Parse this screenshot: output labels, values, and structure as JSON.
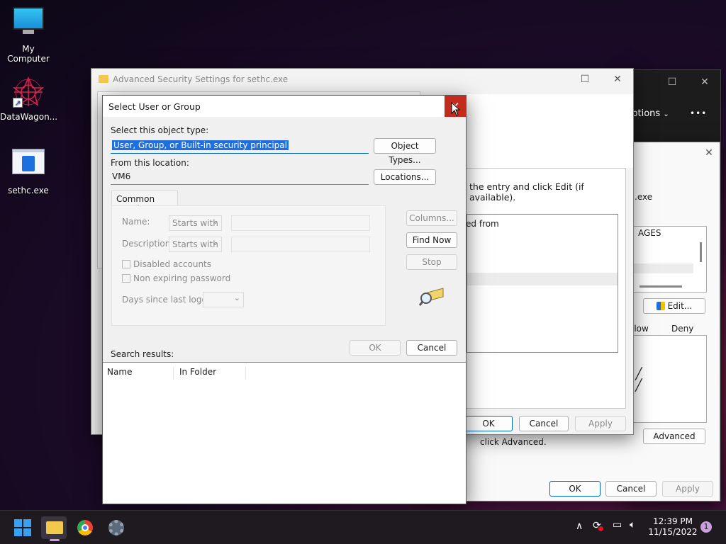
{
  "desktop": {
    "icons": [
      {
        "label": "My Computer"
      },
      {
        "label": "DataWagon..."
      },
      {
        "label": "sethc.exe"
      }
    ]
  },
  "back_window": {
    "menu_options": "Options",
    "more": "•••"
  },
  "properties_window": {
    "file_label": ".exe",
    "principal_label": "AGES",
    "edit_button": "Edit...",
    "col_allow": "llow",
    "col_deny": "Deny",
    "advanced_text": "click Advanced.",
    "advanced_button": "Advanced",
    "ok": "OK",
    "cancel": "Cancel",
    "apply": "Apply"
  },
  "adv_window": {
    "title": "Advanced Security Settings for sethc.exe",
    "instruction": "the entry and click Edit (if available).",
    "inherited": "ed from",
    "ok": "OK",
    "cancel": "Cancel",
    "apply": "Apply"
  },
  "dialog": {
    "title": "Select User or Group",
    "object_type_label": "Select this object type:",
    "object_type_value": "User, Group, or Built-in security principal",
    "object_types_button": "Object Types...",
    "location_label": "From this location:",
    "location_value": "VM6",
    "locations_button": "Locations...",
    "common_queries_tab": "Common Queries",
    "name_label": "Name:",
    "name_mode": "Starts with",
    "description_label": "Description:",
    "description_mode": "Starts with",
    "disabled_accounts": "Disabled accounts",
    "non_expiring": "Non expiring password",
    "days_label": "Days since last logon:",
    "columns_button": "Columns...",
    "find_now_button": "Find Now",
    "stop_button": "Stop",
    "search_results_label": "Search results:",
    "ok": "OK",
    "cancel": "Cancel",
    "results_columns": [
      "Name",
      "In Folder"
    ]
  },
  "taskbar": {
    "time": "12:39 PM",
    "date": "11/15/2022",
    "notification_count": "1"
  },
  "colors": {
    "accent": "#0067c0",
    "close_red": "#c42b1c",
    "selection": "#1e6fe0"
  }
}
